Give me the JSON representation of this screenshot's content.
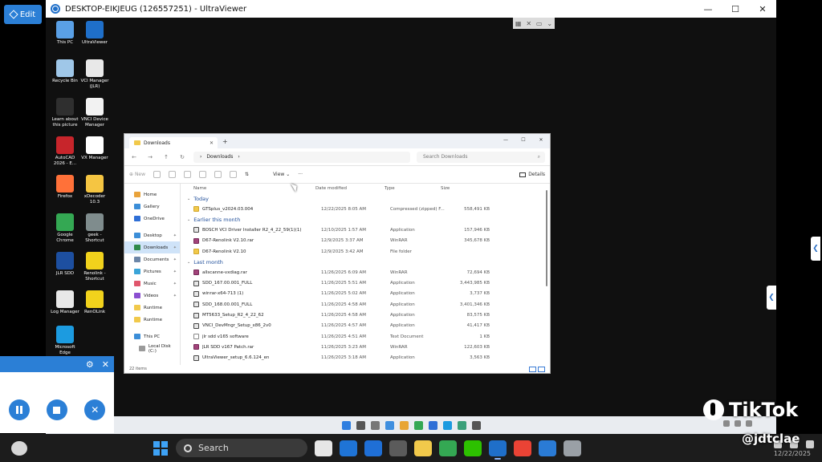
{
  "edit_label": "Edit",
  "uv_window": {
    "title": "DESKTOP-EIKJEUG (126557251) - UltraViewer",
    "minimize": "—",
    "maximize": "☐",
    "close": "✕"
  },
  "desktop_icons": [
    {
      "label": "This PC",
      "color": "#5aa0e6"
    },
    {
      "label": "UltraViewer",
      "color": "#1f6fc9"
    },
    {
      "label": "Recycle Bin",
      "color": "#9fc7e8"
    },
    {
      "label": "VCI Manager (JLR)",
      "color": "#e8e8e8"
    },
    {
      "label": "Learn about this picture",
      "color": "#2f2f2f"
    },
    {
      "label": "VNCI Device Manager",
      "color": "#f2f2f2"
    },
    {
      "label": "AutoCAD 2026 - E...",
      "color": "#c7252b"
    },
    {
      "label": "VX Manager",
      "color": "#ffffff"
    },
    {
      "label": "Firefox",
      "color": "#ff7139"
    },
    {
      "label": "xDecoder 10.3",
      "color": "#f5c542"
    },
    {
      "label": "Google Chrome",
      "color": "#34a853"
    },
    {
      "label": "geek - Shortcut",
      "color": "#7f8c8d"
    },
    {
      "label": "JLR SDD",
      "color": "#1d4fa0"
    },
    {
      "label": "Renolink - Shortcut",
      "color": "#f1d21c"
    },
    {
      "label": "Log Manager",
      "color": "#e8e8e8"
    },
    {
      "label": "RenOLink",
      "color": "#f1d21c"
    },
    {
      "label": "Microsoft Edge",
      "color": "#1c9be0"
    }
  ],
  "explorer": {
    "tab_label": "Downloads",
    "path_label": "Downloads",
    "search_placeholder": "Search Downloads",
    "new_label": "New",
    "view_label": "View",
    "more_label": "···",
    "details_label": "Details",
    "columns": {
      "name": "Name",
      "date": "Date modified",
      "type": "Type",
      "size": "Size"
    },
    "nav": [
      {
        "label": "Home",
        "color": "#e9a33b"
      },
      {
        "label": "Gallery",
        "color": "#3c8ed8"
      },
      {
        "label": "OneDrive",
        "color": "#2f6fd6"
      },
      {
        "label": "Desktop",
        "color": "#3c8ed8"
      },
      {
        "label": "Downloads",
        "color": "#2f8a4a"
      },
      {
        "label": "Documents",
        "color": "#6c86a8"
      },
      {
        "label": "Pictures",
        "color": "#3aa4d8"
      },
      {
        "label": "Music",
        "color": "#e0566c"
      },
      {
        "label": "Videos",
        "color": "#8b4fd1"
      },
      {
        "label": "Runtime",
        "color": "#f1c94b"
      },
      {
        "label": "Runtime",
        "color": "#f1c94b"
      },
      {
        "label": "This PC",
        "color": "#3c8ed8"
      },
      {
        "label": "Local Disk (C:)",
        "color": "#9a9a9a"
      }
    ],
    "groups": [
      {
        "label": "Today",
        "rows": [
          {
            "icon": "folder",
            "name": "GTSplus_v2024.03.004",
            "date": "12/22/2025 8:05 AM",
            "type": "Compressed (zipped) F...",
            "size": "558,491 KB"
          }
        ]
      },
      {
        "label": "Earlier this month",
        "rows": [
          {
            "icon": "app",
            "name": "BOSCH VCI Driver Installer R2_4_22_59(1)(1)",
            "date": "12/10/2025 1:57 AM",
            "type": "Application",
            "size": "157,946 KB"
          },
          {
            "icon": "rar",
            "name": "D67-Renolink V2.10.rar",
            "date": "12/9/2025 3:37 AM",
            "type": "WinRAR",
            "size": "345,678 KB"
          },
          {
            "icon": "folder",
            "name": "D67-Renolink V2.10",
            "date": "12/9/2025 3:42 AM",
            "type": "File folder",
            "size": ""
          }
        ]
      },
      {
        "label": "Last month",
        "rows": [
          {
            "icon": "rar",
            "name": "allscanne-vxdiag.rar",
            "date": "11/26/2025 6:09 AM",
            "type": "WinRAR",
            "size": "72,694 KB"
          },
          {
            "icon": "app",
            "name": "SDD_167.00.001_FULL",
            "date": "11/26/2025 5:51 AM",
            "type": "Application",
            "size": "3,443,985 KB"
          },
          {
            "icon": "app",
            "name": "winrar-x64-713 (1)",
            "date": "11/26/2025 5:02 AM",
            "type": "Application",
            "size": "3,737 KB"
          },
          {
            "icon": "app",
            "name": "SDD_168.00.001_FULL",
            "date": "11/26/2025 4:58 AM",
            "type": "Application",
            "size": "3,401,346 KB"
          },
          {
            "icon": "app",
            "name": "MT5633_Setup_R2_4_22_62",
            "date": "11/26/2025 4:58 AM",
            "type": "Application",
            "size": "83,575 KB"
          },
          {
            "icon": "app",
            "name": "VNCI_DevMngr_Setup_x86_2v0",
            "date": "11/26/2025 4:57 AM",
            "type": "Application",
            "size": "41,417 KB"
          },
          {
            "icon": "txt",
            "name": "jlr sdd v165 software",
            "date": "11/26/2025 4:51 AM",
            "type": "Text Document",
            "size": "1 KB"
          },
          {
            "icon": "rar",
            "name": "JLR SDD v167 Patch.rar",
            "date": "11/26/2025 3:23 AM",
            "type": "WinRAR",
            "size": "122,603 KB"
          },
          {
            "icon": "app",
            "name": "UltraViewer_setup_6.6.124_en",
            "date": "11/26/2025 3:18 AM",
            "type": "Application",
            "size": "3,563 KB"
          }
        ]
      }
    ],
    "status": "22 items"
  },
  "remote_taskbar_icons": [
    "#2f7fe0",
    "#555555",
    "#777777",
    "#3f8fdf",
    "#e8a534",
    "#34a853",
    "#2f6fd6",
    "#1c9be0",
    "#3aa07a",
    "#555555"
  ],
  "control_panel": {
    "gear": "⚙",
    "close": "✕"
  },
  "taskbar": {
    "search_label": "Search",
    "icons": [
      {
        "name": "task-view",
        "color": "#e6e6e6"
      },
      {
        "name": "defender",
        "color": "#1f74d6"
      },
      {
        "name": "outlook",
        "color": "#1f6fd6"
      },
      {
        "name": "calculator",
        "color": "#5b5b5b"
      },
      {
        "name": "file-explorer",
        "color": "#f1c94b"
      },
      {
        "name": "chrome",
        "color": "#34a853"
      },
      {
        "name": "wechat",
        "color": "#2dc100"
      },
      {
        "name": "ultraviewer",
        "color": "#1f6fc9"
      },
      {
        "name": "chrome-profile",
        "color": "#ea4335"
      },
      {
        "name": "snipping",
        "color": "#2a7bd5"
      },
      {
        "name": "settings",
        "color": "#9aa0a6"
      }
    ],
    "date": "12/22/2025"
  },
  "watermark": {
    "brand": "TikTok",
    "handle": "@jdtclae"
  }
}
